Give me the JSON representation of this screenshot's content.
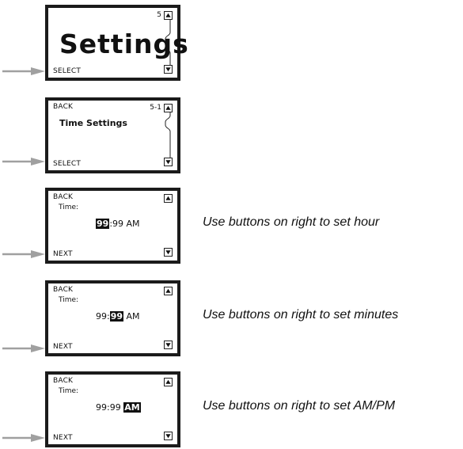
{
  "screens": [
    {
      "top": "",
      "page": "5",
      "title": "Settings",
      "bottom": "SELECT"
    },
    {
      "top": "BACK",
      "page": "5-1",
      "title": "Time Settings",
      "bottom": "SELECT"
    },
    {
      "top": "BACK",
      "label": "Time:",
      "hour": "99",
      "sep1": ":",
      "minutes": "99",
      "sep2": " ",
      "ampm": "AM",
      "bottom": "NEXT"
    },
    {
      "top": "BACK",
      "label": "Time:",
      "hour": "99",
      "sep1": ":",
      "minutes": "99",
      "sep2": " ",
      "ampm": "AM",
      "bottom": "NEXT"
    },
    {
      "top": "BACK",
      "label": "Time:",
      "hour": "99",
      "sep1": ":",
      "minutes": "99",
      "sep2": " ",
      "ampm": "AM",
      "bottom": "NEXT"
    }
  ],
  "instructions": [
    "Use buttons on right to set hour",
    "Use buttons on right to set minutes",
    "Use buttons on right to set AM/PM"
  ],
  "icons": {
    "scroll_up": "triangle-up-icon",
    "scroll_down": "triangle-down-icon",
    "pointer": "arrow-right-icon"
  },
  "colors": {
    "bezel": "#1b1b1b",
    "highlight": "#111111",
    "arrow": "#a0a0a0"
  }
}
